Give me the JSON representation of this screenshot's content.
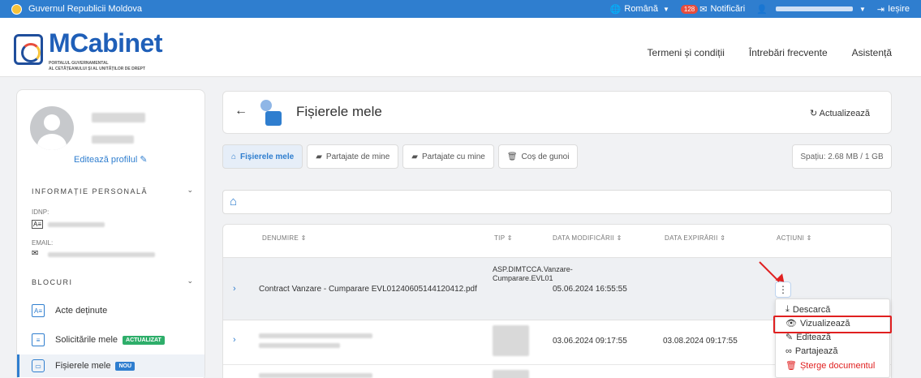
{
  "topbar": {
    "gov_name": "Guvernul Republicii Moldova",
    "language": "Română",
    "notifications_count": "128",
    "notifications_label": "Notificări",
    "logout_label": "Ieșire"
  },
  "header": {
    "logo_title": "MCabinet",
    "logo_sub1": "PORTALUL GUVERNAMENTAL",
    "logo_sub2": "AL CETĂȚEANULUI ȘI AL UNITĂȚILOR DE DREPT",
    "nav": [
      "Termeni și condiții",
      "Întrebări frecvente",
      "Asistență"
    ]
  },
  "sidebar": {
    "edit_profile": "Editează profilul",
    "personal_info_title": "INFORMAȚIE PERSONALĂ",
    "idnp_label": "IDNP:",
    "email_label": "EMAIL:",
    "blocks_title": "BLOCURI",
    "items": [
      {
        "label": "Acte deținute",
        "tag": ""
      },
      {
        "label": "Solicitările mele",
        "tag": "ACTUALIZAT"
      },
      {
        "label": "Fișierele mele",
        "tag": "NOU"
      }
    ]
  },
  "main": {
    "title": "Fișierele mele",
    "refresh": "Actualizează",
    "tabs": [
      "Fișierele mele",
      "Partajate de mine",
      "Partajate cu mine",
      "Coș de gunoi"
    ],
    "space": "Spațiu: 2.68 MB / 1 GB",
    "table": {
      "headers": [
        "DENUMIRE",
        "TIP",
        "DATA MODIFICĂRII",
        "DATA EXPIRĂRII",
        "ACȚIUNI"
      ],
      "rows": [
        {
          "name": "Contract Vanzare - Cumparare EVL01240605144120412.pdf",
          "type": "ASP.DIMTCCA.Vanzare-Cumparare.EVL01",
          "modified": "05.06.2024 16:55:55",
          "expires": ""
        },
        {
          "name": "",
          "type": "",
          "modified": "03.06.2024 09:17:55",
          "expires": "03.08.2024 09:17:55"
        }
      ]
    },
    "actions_menu": [
      "Descarcă",
      "Vizualizează",
      "Editează",
      "Partajează",
      "Șterge documentul"
    ]
  },
  "colors": {
    "accent": "#2f7ecf",
    "danger": "#e02020",
    "success": "#2eae6a"
  }
}
